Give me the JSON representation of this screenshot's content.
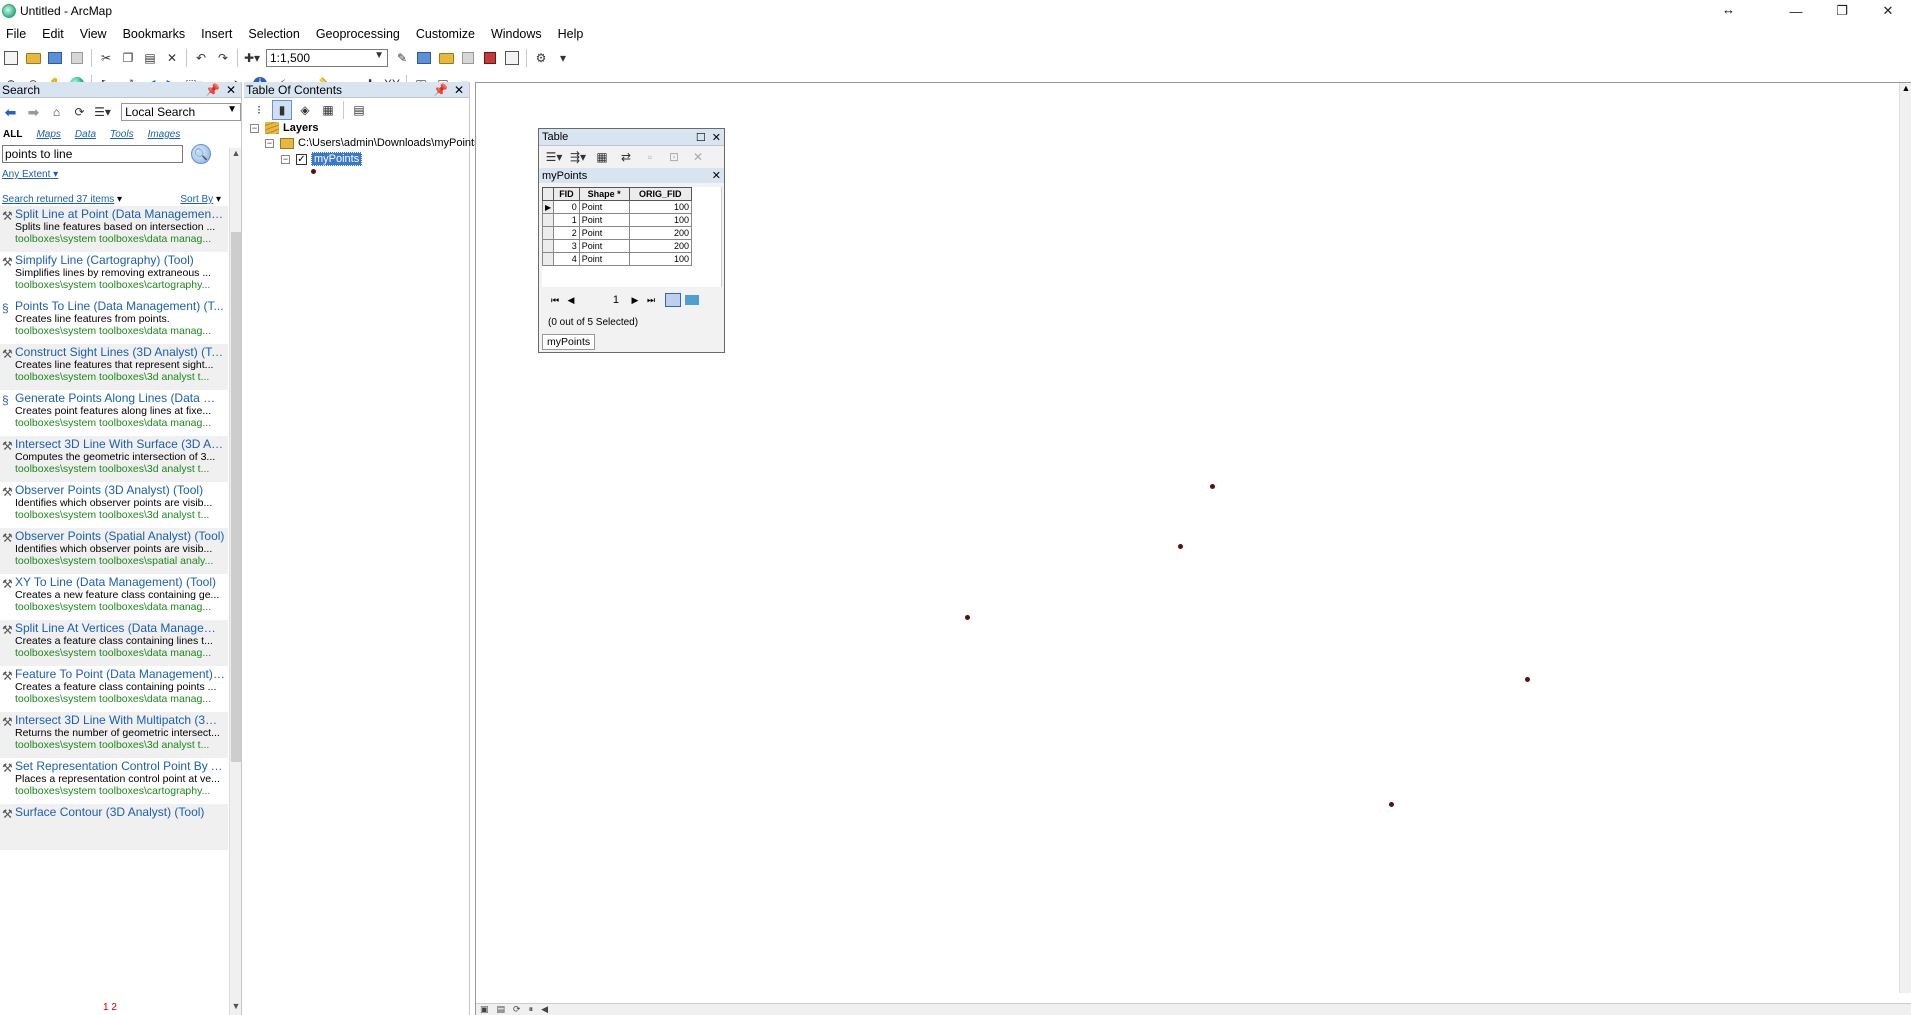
{
  "window": {
    "title": "Untitled - ArcMap",
    "resize_glyph": "↔",
    "minimize": "—",
    "restore": "❐",
    "close": "✕"
  },
  "menu": [
    "File",
    "Edit",
    "View",
    "Bookmarks",
    "Insert",
    "Selection",
    "Geoprocessing",
    "Customize",
    "Windows",
    "Help"
  ],
  "toolbar": {
    "scale_value": "1:1,500"
  },
  "search_pane": {
    "title": "Search",
    "scope_value": "Local Search",
    "tabs": [
      "ALL",
      "Maps",
      "Data",
      "Tools",
      "Images"
    ],
    "query": "points to line",
    "extent_label": "Any Extent",
    "results_count": "Search returned 37 items",
    "sort_label": "Sort By",
    "pager": "1 2",
    "results": [
      {
        "title": "Split Line at Point (Data Management)...",
        "desc": "Splits line features based on intersection ...",
        "path": "toolboxes\\system toolboxes\\data manag..."
      },
      {
        "title": "Simplify Line (Cartography) (Tool)",
        "desc": "Simplifies lines by removing extraneous ...",
        "path": "toolboxes\\system toolboxes\\cartography..."
      },
      {
        "title": "Points To Line (Data Management) (T...",
        "desc": "Creates line features from points.",
        "path": "toolboxes\\system toolboxes\\data manag..."
      },
      {
        "title": "Construct Sight Lines (3D Analyst) (To...",
        "desc": "Creates line features that represent sight...",
        "path": "toolboxes\\system toolboxes\\3d analyst t..."
      },
      {
        "title": "Generate Points Along Lines (Data Ma...",
        "desc": "Creates point features along lines at fixe...",
        "path": "toolboxes\\system toolboxes\\data manag..."
      },
      {
        "title": "Intersect 3D Line With Surface (3D An...",
        "desc": "Computes the geometric intersection of 3...",
        "path": "toolboxes\\system toolboxes\\3d analyst t..."
      },
      {
        "title": "Observer Points (3D Analyst) (Tool)",
        "desc": "Identifies which observer points are visib...",
        "path": "toolboxes\\system toolboxes\\3d analyst t..."
      },
      {
        "title": "Observer Points (Spatial Analyst) (Tool)",
        "desc": "Identifies which observer points are visib...",
        "path": "toolboxes\\system toolboxes\\spatial analy..."
      },
      {
        "title": "XY To Line (Data Management) (Tool)",
        "desc": "Creates a new feature class containing ge...",
        "path": "toolboxes\\system toolboxes\\data manag..."
      },
      {
        "title": "Split Line At Vertices (Data Manageme...",
        "desc": "Creates a feature class containing lines t...",
        "path": "toolboxes\\system toolboxes\\data manag..."
      },
      {
        "title": "Feature To Point (Data Management) ...",
        "desc": "Creates a feature class containing points ...",
        "path": "toolboxes\\system toolboxes\\data manag..."
      },
      {
        "title": "Intersect 3D Line With Multipatch (3D ...",
        "desc": "Returns the number of geometric intersect...",
        "path": "toolboxes\\system toolboxes\\3d analyst t..."
      },
      {
        "title": "Set Representation Control Point By A...",
        "desc": "Places a representation control point at ve...",
        "path": "toolboxes\\system toolboxes\\cartography..."
      },
      {
        "title": "Surface Contour (3D Analyst) (Tool)",
        "desc": "",
        "path": ""
      }
    ]
  },
  "toc": {
    "title": "Table Of Contents",
    "layers_label": "Layers",
    "folder_path": "C:\\Users\\admin\\Downloads\\myPoints",
    "layer_name": "myPoints"
  },
  "table_window": {
    "title": "Table",
    "layer_tab_title": "myPoints",
    "columns": [
      "FID",
      "Shape *",
      "ORIG_FID"
    ],
    "rows": [
      {
        "fid": "0",
        "shape": "Point",
        "orig_fid": "100"
      },
      {
        "fid": "1",
        "shape": "Point",
        "orig_fid": "100"
      },
      {
        "fid": "2",
        "shape": "Point",
        "orig_fid": "200"
      },
      {
        "fid": "3",
        "shape": "Point",
        "orig_fid": "200"
      },
      {
        "fid": "4",
        "shape": "Point",
        "orig_fid": "100"
      }
    ],
    "current_record": "1",
    "status": "(0 out of 5 Selected)",
    "bottom_tab": "myPoints"
  }
}
